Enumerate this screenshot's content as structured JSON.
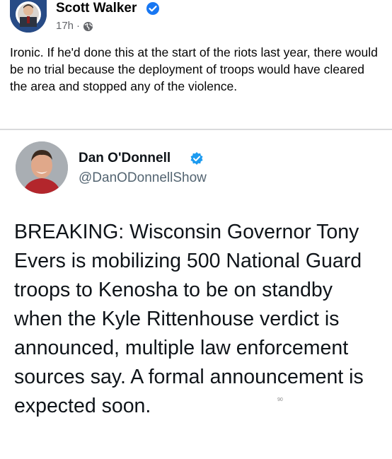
{
  "fb_post": {
    "author": "Scott Walker",
    "timestamp": "17h",
    "separator_dot": "·",
    "privacy_icon": "globe-icon",
    "text": "Ironic. If he'd done this at the start of the riots last year, there would be no trial because the deployment of troops would have cleared the area and stopped any of the violence."
  },
  "tweet": {
    "author": "Dan O'Donnell",
    "handle": "@DanODonnellShow",
    "text": "BREAKING: Wisconsin Governor Tony Evers is mobilizing 500 National Guard troops to Kenosha to be on standby when the Kyle Rittenhouse verdict is announced, multiple law enforcement sources say. A formal announcement is expected soon.",
    "watermark": "90"
  },
  "colors": {
    "fb_verified": "#1877f2",
    "tw_verified": "#1d9bf0",
    "meta_gray": "#65676b",
    "handle_gray": "#536471",
    "separator": "#d9dadc"
  }
}
